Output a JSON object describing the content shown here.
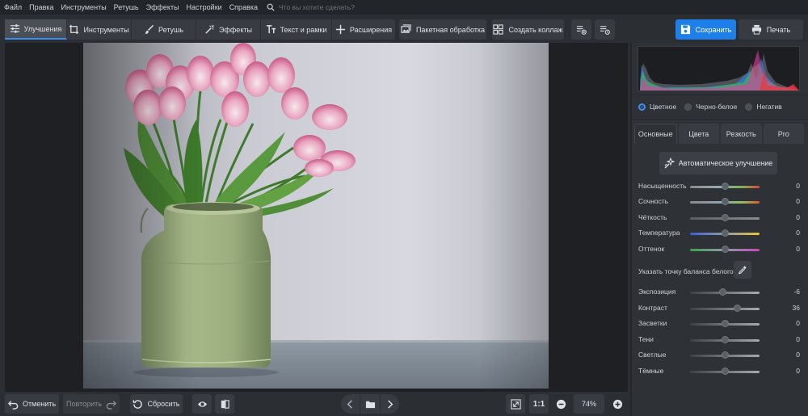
{
  "menu": [
    "Файл",
    "Правка",
    "Инструменты",
    "Ретушь",
    "Эффекты",
    "Настройки",
    "Справка"
  ],
  "search": {
    "placeholder": "Что вы хотите сделать?"
  },
  "tabs": [
    {
      "label": "Улучшения",
      "icon": "sliders-icon",
      "active": true
    },
    {
      "label": "Инструменты",
      "icon": "crop-icon",
      "active": false
    },
    {
      "label": "Ретушь",
      "icon": "brush-icon",
      "active": false
    },
    {
      "label": "Эффекты",
      "icon": "magic-wand-icon",
      "active": false
    },
    {
      "label": "Текст и рамки",
      "icon": "text-icon",
      "active": false
    },
    {
      "label": "Расширения",
      "icon": "plus-icon",
      "active": false
    }
  ],
  "toolbar": {
    "batch_label": "Пакетная обработка",
    "collage_label": "Создать коллаж",
    "save_label": "Сохранить",
    "print_label": "Печать"
  },
  "bottom": {
    "undo_label": "Отменить",
    "redo_label": "Повторить",
    "reset_label": "Сбросить",
    "ratio_label": "1:1",
    "zoom": "74%"
  },
  "panel": {
    "modes": [
      {
        "label": "Цветное",
        "selected": true
      },
      {
        "label": "Черно-белое",
        "selected": false
      },
      {
        "label": "Негатив",
        "selected": false
      }
    ],
    "tabs": [
      {
        "label": "Основные",
        "active": true
      },
      {
        "label": "Цвета",
        "active": false
      },
      {
        "label": "Резкость",
        "active": false
      },
      {
        "label": "Pro",
        "active": false
      }
    ],
    "auto_label": "Автоматическое улучшение",
    "white_balance_label": "Указать точку баланса белого",
    "sliders": [
      {
        "name": "Насыщенность",
        "value": 0,
        "min": -100,
        "max": 100,
        "gradient": "linear-gradient(90deg,#8a8a8a,#9aa8b4 40%,#7fb05a 75%,#e0463a)"
      },
      {
        "name": "Сочность",
        "value": 0,
        "min": -100,
        "max": 100,
        "gradient": "linear-gradient(90deg,#8a8a8a,#8fa0b0 40%,#8fc060 75%,#e5532f)"
      },
      {
        "name": "Чёткость",
        "value": 0,
        "min": -100,
        "max": 100,
        "gradient": "linear-gradient(90deg,#5a5d62,#8a8d92)"
      },
      {
        "name": "Температура",
        "value": 0,
        "min": -100,
        "max": 100,
        "gradient": "linear-gradient(90deg,#3b5fd6,#8f9aa8 50%,#e6c335)"
      },
      {
        "name": "Оттенок",
        "value": 0,
        "min": -100,
        "max": 100,
        "gradient": "linear-gradient(90deg,#3aa34a,#8f9aa8 50%,#c04ab8)"
      },
      {
        "name": "Экспозиция",
        "value": -6,
        "min": -100,
        "max": 100,
        "gradient": "linear-gradient(90deg,#3e4146,#a6a9ad)"
      },
      {
        "name": "Контраст",
        "value": 36,
        "min": -100,
        "max": 100,
        "gradient": "linear-gradient(90deg,#3e4146,#a6a9ad)"
      },
      {
        "name": "Засветки",
        "value": 0,
        "min": -100,
        "max": 100,
        "gradient": "linear-gradient(90deg,#3e4146,#a6a9ad)"
      },
      {
        "name": "Тени",
        "value": 0,
        "min": -100,
        "max": 100,
        "gradient": "linear-gradient(90deg,#3e4146,#a6a9ad)"
      },
      {
        "name": "Светлые",
        "value": 0,
        "min": -100,
        "max": 100,
        "gradient": "linear-gradient(90deg,#3e4146,#a6a9ad)"
      },
      {
        "name": "Тёмные",
        "value": 0,
        "min": -100,
        "max": 100,
        "gradient": "linear-gradient(90deg,#3e4146,#a6a9ad)"
      }
    ]
  },
  "colors": {
    "accent": "#3b8ff0",
    "save_button": "#1f7fe8",
    "background": "#2b2e33"
  }
}
